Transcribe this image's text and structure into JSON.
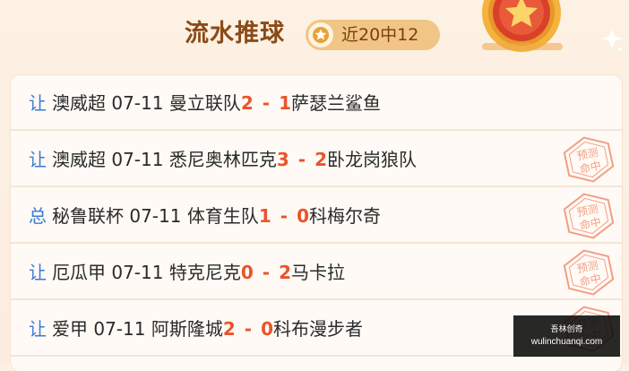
{
  "header": {
    "title": "流水推球",
    "record_label": "近20中12",
    "colors": {
      "title": "#8b4a17",
      "pill": "#f0c585",
      "accent": "#e9542a",
      "tag": "#3a79d6"
    }
  },
  "matches": [
    {
      "tag": "让",
      "league": "澳威超",
      "date": "07-11",
      "home": "曼立联队",
      "home_score": "2",
      "dash": "-",
      "away_score": "1",
      "away": "萨瑟兰鲨鱼",
      "stamp": false
    },
    {
      "tag": "让",
      "league": "澳威超",
      "date": "07-11",
      "home": "悉尼奥林匹克",
      "home_score": "3",
      "dash": "-",
      "away_score": "2",
      "away": "卧龙岗狼队",
      "stamp": true
    },
    {
      "tag": "总",
      "league": "秘鲁联杯",
      "date": "07-11",
      "home": "体育生队",
      "home_score": "1",
      "dash": "-",
      "away_score": "0",
      "away": "科梅尔奇",
      "stamp": true
    },
    {
      "tag": "让",
      "league": "厄瓜甲",
      "date": "07-11",
      "home": "特克尼克",
      "home_score": "0",
      "dash": "-",
      "away_score": "2",
      "away": "马卡拉",
      "stamp": true
    },
    {
      "tag": "让",
      "league": "爱甲",
      "date": "07-11",
      "home": "阿斯隆城",
      "home_score": "2",
      "dash": "-",
      "away_score": "0",
      "away": "科布漫步者",
      "stamp": true
    }
  ],
  "stamp_text": {
    "line1": "预测",
    "line2": "命中"
  },
  "watermark": {
    "top": "吾林创奇",
    "url": "wulinchuanqi.com"
  }
}
